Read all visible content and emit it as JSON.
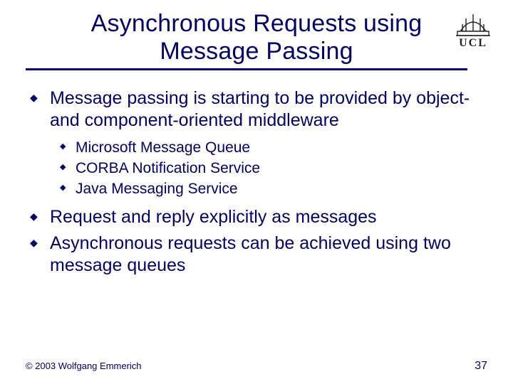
{
  "title_line1": "Asynchronous Requests using",
  "title_line2": "Message Passing",
  "logo_label": "UCL",
  "bullets": [
    {
      "text": "Message passing is starting to be provided by object- and component-oriented middleware",
      "sub": [
        "Microsoft Message Queue",
        "CORBA Notification Service",
        "Java Messaging Service"
      ]
    },
    {
      "text": "Request and reply explicitly as messages"
    },
    {
      "text": "Asynchronous requests can be achieved using two message queues"
    }
  ],
  "copyright": "© 2003 Wolfgang Emmerich",
  "page_number": "37"
}
